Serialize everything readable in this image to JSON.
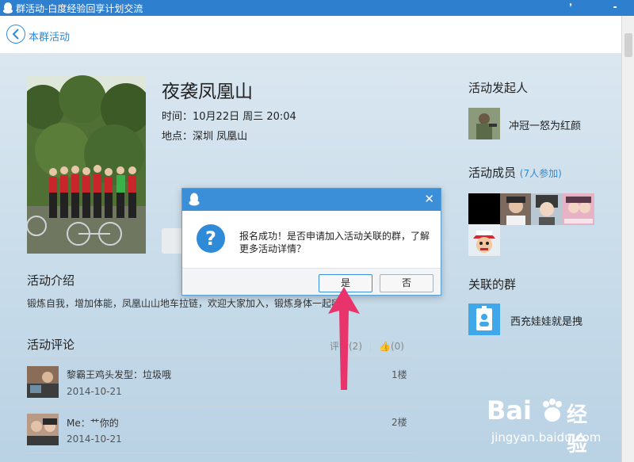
{
  "window": {
    "title": "群活动-白度经验回享计划交流"
  },
  "nav": {
    "back_label": "本群活动"
  },
  "activity": {
    "title": "夜袭凤凰山",
    "time": "时间：10月22日 周三 20:04",
    "place": "地点：深圳 凤凰山"
  },
  "intro": {
    "heading": "活动介绍",
    "text": "锻炼自我，增加体能，凤凰山山地车拉链，欢迎大家加入，锻炼身体一起嗨"
  },
  "comments": {
    "heading": "活动评论",
    "count_label": "评论(2)",
    "likes_label": "(0)",
    "items": [
      {
        "text": "黎霸王鸡头发型：垃圾哦",
        "date": "2014-10-21",
        "floor": "1楼"
      },
      {
        "text": "Me：艹你的",
        "date": "2014-10-21",
        "floor": "2楼"
      }
    ]
  },
  "organizer": {
    "heading": "活动发起人",
    "name": "冲冠一怒为红颜"
  },
  "members": {
    "heading": "活动成员",
    "count": "(7人参加)"
  },
  "group": {
    "heading": "关联的群",
    "name": "西充娃娃就是拽"
  },
  "dialog": {
    "message": "报名成功！是否申请加入活动关联的群，了解更多活动详情？",
    "yes": "是",
    "no": "否"
  },
  "watermark": {
    "brand_left": "Bai",
    "brand_right": "经验",
    "url": "jingyan.baidu.com"
  },
  "colors": {
    "accent": "#2f8ad8",
    "title_bar": "#2f7fcf",
    "arrow": "#e8336b"
  }
}
